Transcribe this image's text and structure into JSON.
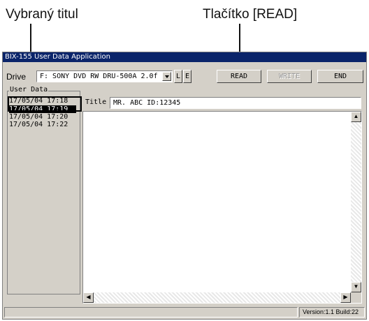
{
  "callouts": {
    "selected_title": "Vybraný titul",
    "read_button": "Tlačítko [READ]"
  },
  "window": {
    "title": "BIX-155 User Data Application"
  },
  "toolbar": {
    "drive_label": "Drive",
    "drive_value": "F: SONY    DVD RW DRU-500A 2.0f",
    "l_label": "L",
    "e_label": "E",
    "read_label": "READ",
    "write_label": "WRITE",
    "end_label": "END"
  },
  "user_data": {
    "group_label": "User Data",
    "items": [
      {
        "label": "17/05/04 17:18",
        "selected": false
      },
      {
        "label": "17/05/04 17:19",
        "selected": true
      },
      {
        "label": "17/05/04 17:20",
        "selected": false
      },
      {
        "label": "17/05/04 17:22",
        "selected": false
      }
    ]
  },
  "title_field": {
    "label": "Title",
    "value": "MR. ABC ID:12345"
  },
  "statusbar": {
    "version": "Version:1.1 Build:22"
  },
  "icons": {
    "dropdown": "chevron-down-icon",
    "scroll_up": "arrow-up-icon",
    "scroll_down": "arrow-down-icon",
    "scroll_left": "arrow-left-icon",
    "scroll_right": "arrow-right-icon"
  }
}
